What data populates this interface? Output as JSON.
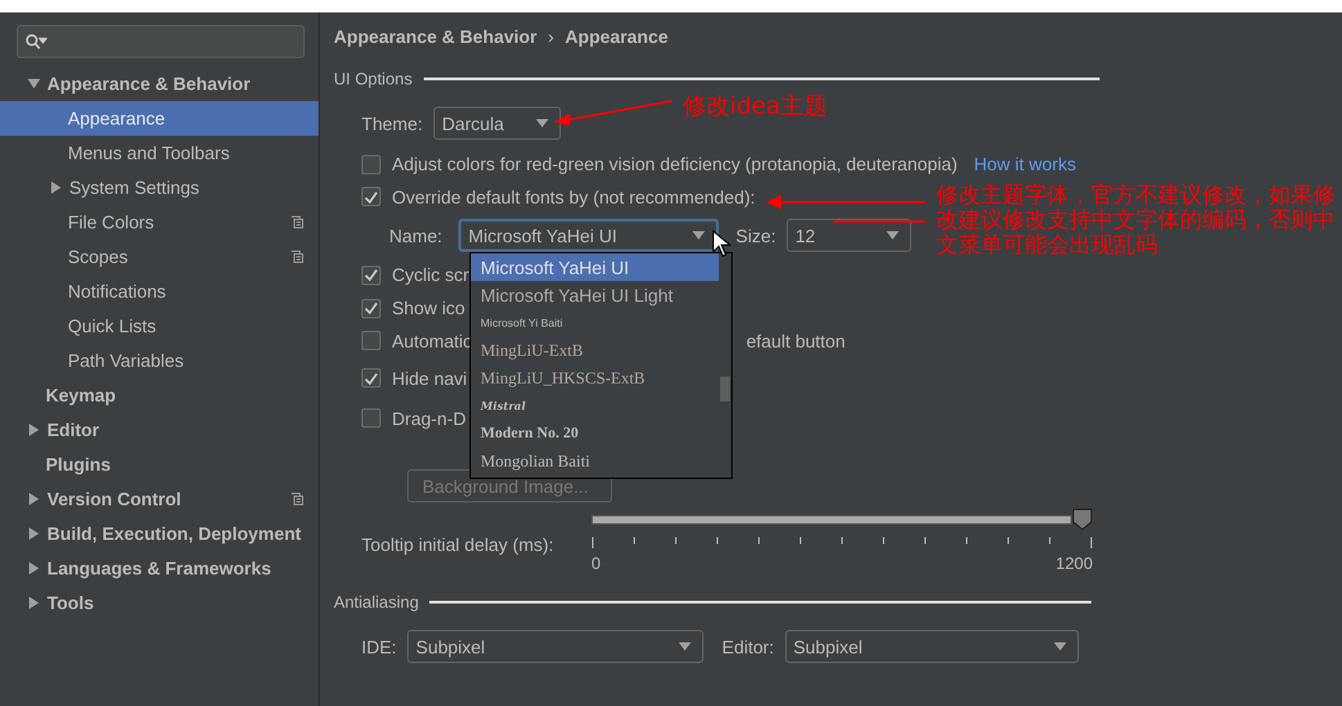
{
  "sidebar": {
    "items": [
      {
        "label": "Appearance & Behavior",
        "expanded": true,
        "selected": false,
        "project_level": false,
        "children": [
          {
            "label": "Appearance",
            "selected": true,
            "project_level": false
          },
          {
            "label": "Menus and Toolbars",
            "selected": false,
            "project_level": false
          },
          {
            "label": "System Settings",
            "expanded": false,
            "selected": false,
            "project_level": false
          },
          {
            "label": "File Colors",
            "selected": false,
            "project_level": true
          },
          {
            "label": "Scopes",
            "selected": false,
            "project_level": true
          },
          {
            "label": "Notifications",
            "selected": false,
            "project_level": false
          },
          {
            "label": "Quick Lists",
            "selected": false,
            "project_level": false
          },
          {
            "label": "Path Variables",
            "selected": false,
            "project_level": false
          }
        ]
      },
      {
        "label": "Keymap",
        "selected": false,
        "project_level": false
      },
      {
        "label": "Editor",
        "expanded": false,
        "selected": false,
        "project_level": false
      },
      {
        "label": "Plugins",
        "selected": false,
        "project_level": false
      },
      {
        "label": "Version Control",
        "expanded": false,
        "selected": false,
        "project_level": true
      },
      {
        "label": "Build, Execution, Deployment",
        "expanded": false,
        "selected": false,
        "project_level": false
      },
      {
        "label": "Languages & Frameworks",
        "expanded": false,
        "selected": false,
        "project_level": false
      },
      {
        "label": "Tools",
        "expanded": false,
        "selected": false,
        "project_level": false
      }
    ]
  },
  "breadcrumb": [
    "Appearance & Behavior",
    "›",
    "Appearance"
  ],
  "ui_options": {
    "title": "UI Options",
    "theme": {
      "label": "Theme:",
      "value": "Darcula"
    },
    "checkboxes": [
      {
        "label": "Adjust colors for red-green vision deficiency (protanopia, deuteranopia)",
        "checked": false,
        "link": "How it works"
      },
      {
        "label": "Override default fonts by (not recommended):",
        "checked": true
      },
      {
        "label": "Cyclic scr",
        "checked": true
      },
      {
        "label": "Show ico",
        "checked": true
      },
      {
        "label": "Automatic",
        "checked": false,
        "label_right": "efault button"
      },
      {
        "label": "Hide navi",
        "checked": true
      },
      {
        "label": "Drag-n-D",
        "checked": false
      }
    ],
    "font_name": {
      "label": "Name:",
      "value": "Microsoft YaHei UI"
    },
    "font_size": {
      "label": "Size:",
      "value": "12"
    },
    "font_list": [
      {
        "label": "Microsoft YaHei UI",
        "kind": "sans",
        "selected": true
      },
      {
        "label": "Microsoft YaHei UI Light",
        "kind": "light",
        "selected": false
      },
      {
        "label": "Microsoft Yi Baiti",
        "kind": "tiny",
        "selected": false
      },
      {
        "label": "MingLiU-ExtB",
        "kind": "serif",
        "selected": false
      },
      {
        "label": "MingLiU_HKSCS-ExtB",
        "kind": "serif",
        "selected": false
      },
      {
        "label": "Mistral",
        "kind": "script",
        "selected": false
      },
      {
        "label": "Modern No. 20",
        "kind": "bold-serif",
        "selected": false
      },
      {
        "label": "Mongolian Baiti",
        "kind": "serif-plain",
        "selected": false
      }
    ],
    "background_button": {
      "label": "Background Image...",
      "disabled": true
    },
    "tooltip_delay": {
      "label": "Tooltip initial delay (ms):",
      "level": 1.0,
      "min": "0",
      "max": "1200"
    }
  },
  "antialiasing": {
    "title": "Antialiasing",
    "ide": {
      "label": "IDE:",
      "value": "Subpixel"
    },
    "editor": {
      "label": "Editor:",
      "value": "Subpixel"
    }
  },
  "annotations": [
    "修改idea主题",
    "修改主题字体，官方不建议修改，如果修改建议修改支持中文字体的编码，否则中文菜单可能会出现乱码"
  ]
}
